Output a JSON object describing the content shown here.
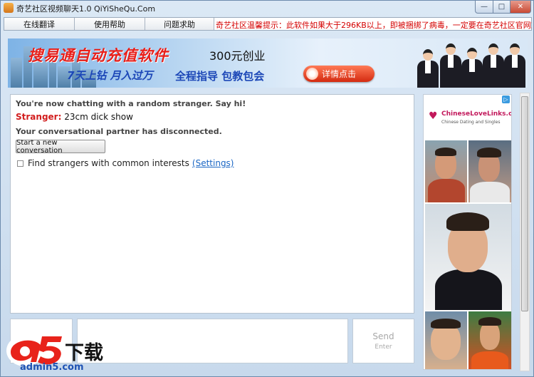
{
  "window": {
    "title": "奇艺社区视频聊天1.0 QiYiSheQu.Com",
    "controls": {
      "minimize": "—",
      "maximize": "□",
      "close": "✕"
    }
  },
  "menu": {
    "tabs": [
      {
        "label": "在线翻译"
      },
      {
        "label": "使用帮助"
      },
      {
        "label": "问题求助"
      }
    ],
    "notice": "奇艺社区温馨提示：此软件如果大于296KB以上，即被捆绑了病毒，一定要在奇艺社区官网或大型软件站下载"
  },
  "banner": {
    "title": "搜易通自动充值软件",
    "price": "300元创业",
    "line1": "7天上钻 月入过万",
    "line2": "全程指导 包教包会",
    "button": "详情点击"
  },
  "chat": {
    "intro": "You're now chatting with a random stranger. Say hi!",
    "stranger_label": "Stranger:",
    "stranger_message": "23cm dick show",
    "disconnect": "Your conversational partner has disconnected.",
    "new_conversation_button": "Start a new conversation",
    "find_interests_label": "Find strangers with common interests",
    "settings_link": "(Settings)"
  },
  "compose": {
    "send_label": "Send",
    "send_hint": "Enter"
  },
  "side_ad": {
    "badge": "▷",
    "site": "ChineseLoveLinks.com",
    "tagline": "Chinese Dating and Singles"
  },
  "watermark": {
    "logo_text": "a5",
    "download_text": "下载",
    "domain": "admin5.com"
  },
  "colors": {
    "notice_red": "#d40000",
    "stranger_red": "#d21d1d",
    "link_blue": "#1a66c4",
    "banner_title_red": "#e8201b",
    "banner_text_blue": "#1c47b7"
  }
}
